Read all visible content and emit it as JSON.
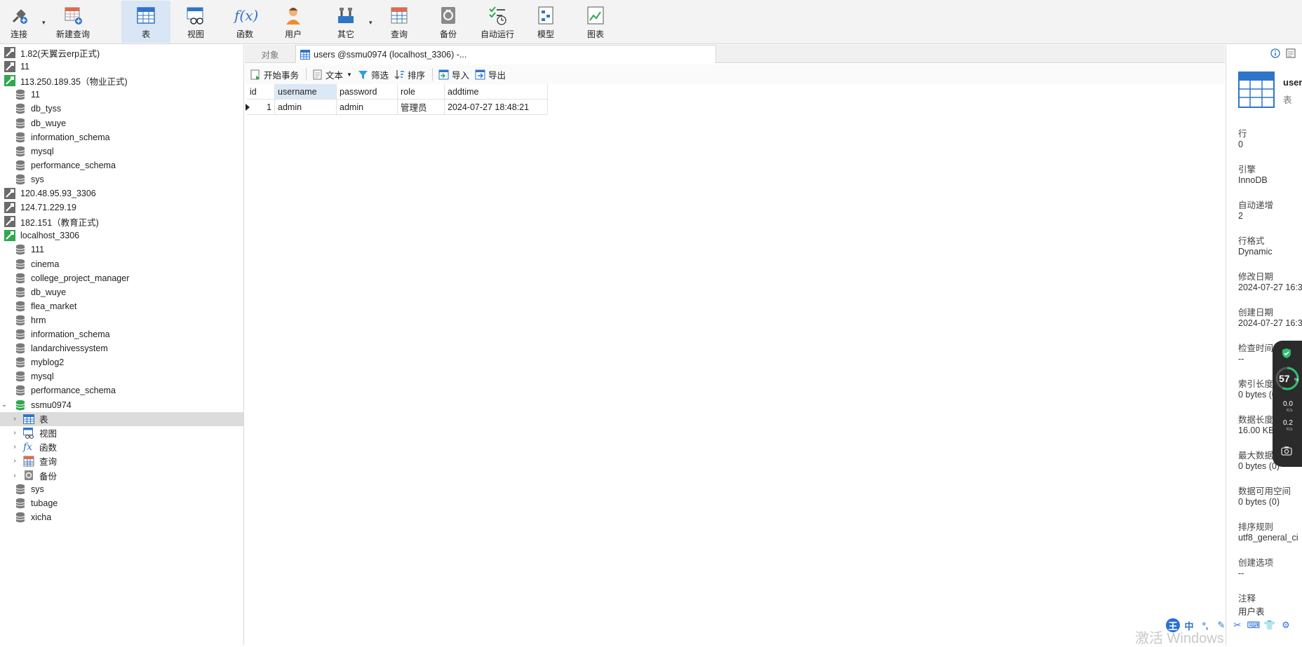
{
  "toolbar": {
    "connect": "连接",
    "new_query": "新建查询",
    "table": "表",
    "view": "视图",
    "function": "函数",
    "user": "用户",
    "other": "其它",
    "query": "查询",
    "backup": "备份",
    "automation": "自动运行",
    "model": "模型",
    "chart": "图表",
    "function_glyph": "f(x)"
  },
  "nav": {
    "items": [
      {
        "label": "1.82(天翼云erp正式)",
        "kind": "conn-off"
      },
      {
        "label": "11",
        "kind": "conn-off"
      },
      {
        "label": "113.250.189.35（物业正式)",
        "kind": "conn-on"
      },
      {
        "label": "11",
        "kind": "db"
      },
      {
        "label": "db_tyss",
        "kind": "db"
      },
      {
        "label": "db_wuye",
        "kind": "db"
      },
      {
        "label": "information_schema",
        "kind": "db"
      },
      {
        "label": "mysql",
        "kind": "db"
      },
      {
        "label": "performance_schema",
        "kind": "db"
      },
      {
        "label": "sys",
        "kind": "db"
      },
      {
        "label": "120.48.95.93_3306",
        "kind": "conn-off"
      },
      {
        "label": "124.71.229.19",
        "kind": "conn-off"
      },
      {
        "label": "182.151（教育正式)",
        "kind": "conn-off"
      },
      {
        "label": "localhost_3306",
        "kind": "conn-on"
      },
      {
        "label": "111",
        "kind": "db"
      },
      {
        "label": "cinema",
        "kind": "db"
      },
      {
        "label": "college_project_manager",
        "kind": "db"
      },
      {
        "label": "db_wuye",
        "kind": "db"
      },
      {
        "label": "flea_market",
        "kind": "db"
      },
      {
        "label": "hrm",
        "kind": "db"
      },
      {
        "label": "information_schema",
        "kind": "db"
      },
      {
        "label": "landarchivessystem",
        "kind": "db"
      },
      {
        "label": "myblog2",
        "kind": "db"
      },
      {
        "label": "mysql",
        "kind": "db"
      },
      {
        "label": "performance_schema",
        "kind": "db"
      },
      {
        "label": "ssmu0974",
        "kind": "db-open"
      },
      {
        "label": "表",
        "kind": "sub-table"
      },
      {
        "label": "视图",
        "kind": "sub-view"
      },
      {
        "label": "函数",
        "kind": "sub-func"
      },
      {
        "label": "查询",
        "kind": "sub-query"
      },
      {
        "label": "备份",
        "kind": "sub-backup"
      },
      {
        "label": "sys",
        "kind": "db"
      },
      {
        "label": "tubage",
        "kind": "db"
      },
      {
        "label": "xicha",
        "kind": "db"
      }
    ]
  },
  "tabs": {
    "objects": "对象",
    "active": "users @ssmu0974 (localhost_3306) -..."
  },
  "subbar": {
    "begin_tx": "开始事务",
    "text": "文本",
    "filter": "筛选",
    "sort": "排序",
    "import": "导入",
    "export": "导出"
  },
  "grid": {
    "columns": [
      "id",
      "username",
      "password",
      "role",
      "addtime"
    ],
    "rows": [
      [
        "1",
        "admin",
        "admin",
        "管理员",
        "2024-07-27 18:48:21"
      ]
    ]
  },
  "info": {
    "title": "user",
    "subtitle": "表",
    "fields": [
      {
        "label": "行",
        "value": "0"
      },
      {
        "label": "引擎",
        "value": "InnoDB"
      },
      {
        "label": "自动递增",
        "value": "2"
      },
      {
        "label": "行格式",
        "value": "Dynamic"
      },
      {
        "label": "修改日期",
        "value": "2024-07-27 16:3"
      },
      {
        "label": "创建日期",
        "value": "2024-07-27 16:3"
      },
      {
        "label": "检查时间",
        "value": "--"
      },
      {
        "label": "索引长度",
        "value": "0 bytes (0)"
      },
      {
        "label": "数据长度",
        "value": "16.00 KB"
      },
      {
        "label": "最大数据",
        "value": "0 bytes (0)"
      },
      {
        "label": "数据可用空间",
        "value": "0 bytes (0)"
      },
      {
        "label": "排序规则",
        "value": "utf8_general_ci"
      },
      {
        "label": "创建选项",
        "value": "--"
      },
      {
        "label": "注释",
        "value": "用户表"
      }
    ]
  },
  "speed": {
    "percent": "57",
    "percent_unit": "%",
    "up": "0.0",
    "down": "0.2",
    "unit": "K/s"
  },
  "watermark": "激活 Windows",
  "ime": {
    "items": [
      "王",
      "中",
      "°,",
      "✎",
      "✂",
      "⌨",
      "👕",
      "⚙"
    ]
  },
  "colors": {
    "accent": "#2e75c9",
    "db_green": "#2fa84f",
    "toolbar_active": "#d8e6f5"
  }
}
